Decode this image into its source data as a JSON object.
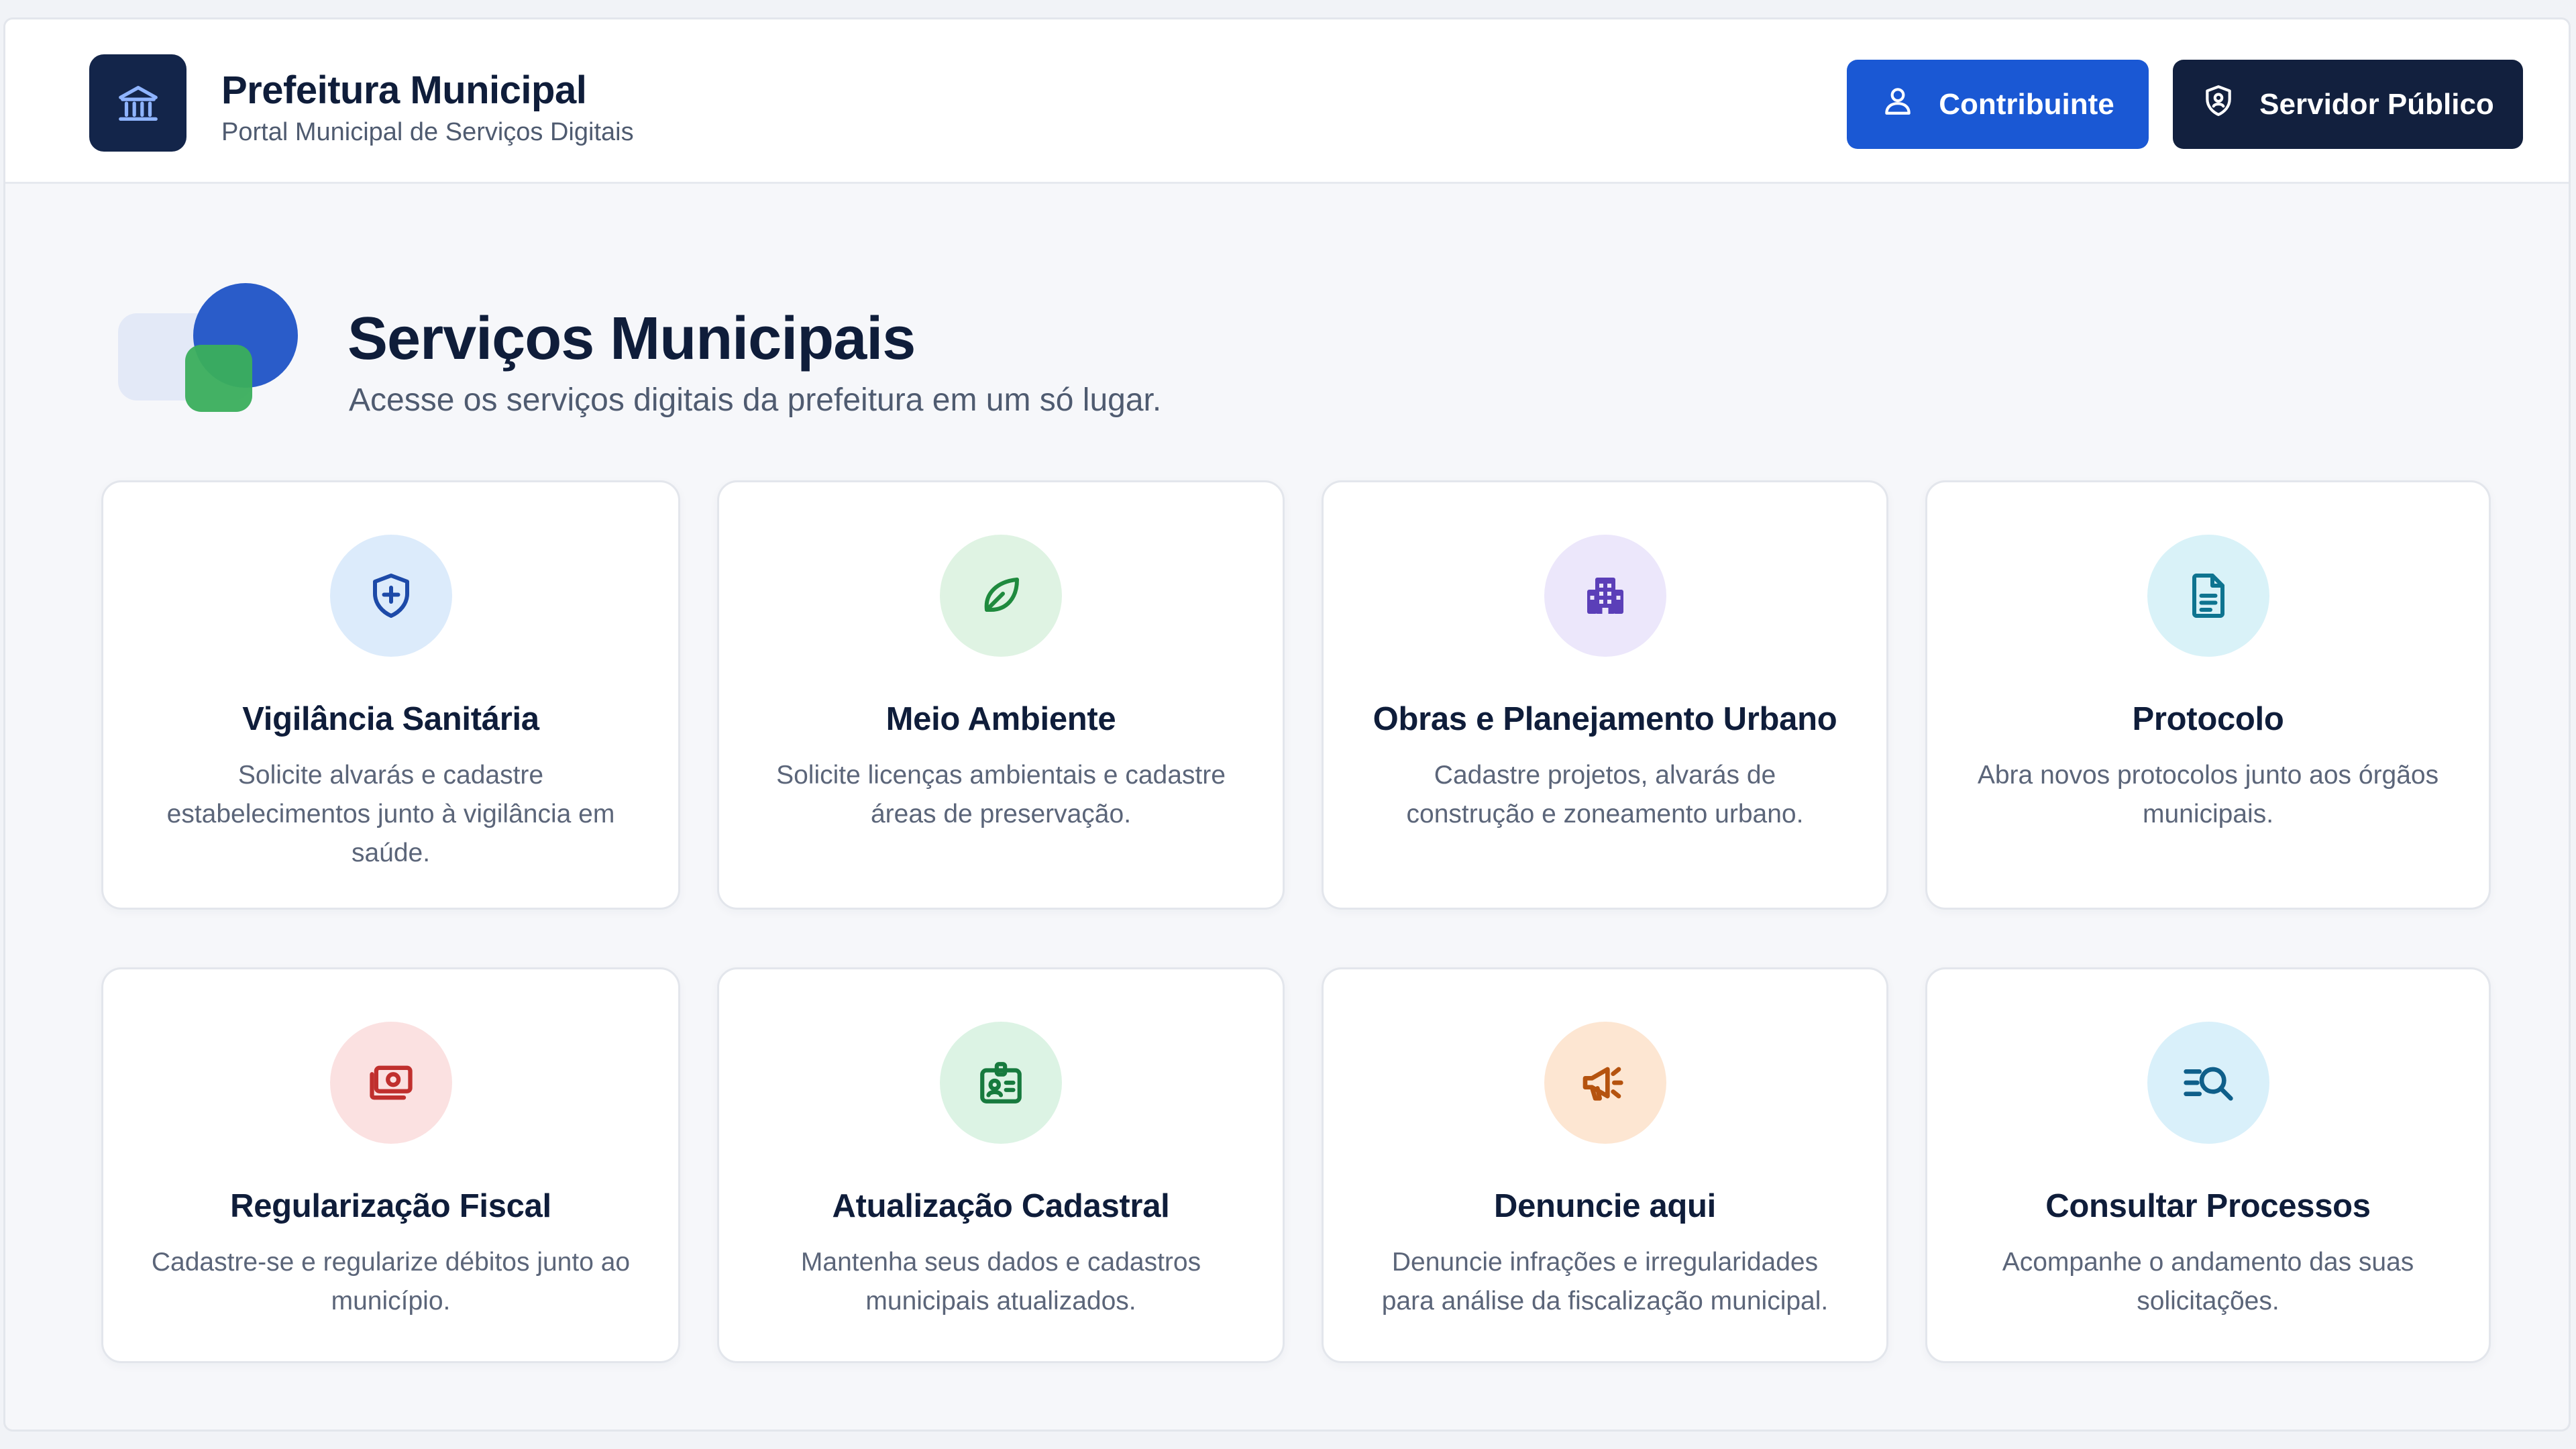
{
  "header": {
    "title": "Prefeitura Municipal",
    "subtitle": "Portal Municipal de Serviços Digitais",
    "btn_contribuinte": "Contribuinte",
    "btn_servidor": "Servidor Público"
  },
  "hero": {
    "title": "Serviços Municipais",
    "subtitle": "Acesse os serviços digitais da prefeitura em um só lugar."
  },
  "colors": {
    "primary": "#1a58d4",
    "navy": "#12203e"
  },
  "services": [
    {
      "title": "Vigilância Sanitária",
      "desc": "Solicite alvarás e cadastre estabelecimentos junto à vigilância em saúde.",
      "icon": "shield-plus-icon"
    },
    {
      "title": "Meio Ambiente",
      "desc": "Solicite licenças ambientais e cadastre áreas de preservação.",
      "icon": "leaf-icon"
    },
    {
      "title": "Obras e Planejamento Urbano",
      "desc": "Cadastre projetos, alvarás de construção e zoneamento urbano.",
      "icon": "building-icon"
    },
    {
      "title": "Protocolo",
      "desc": "Abra novos protocolos junto aos órgãos municipais.",
      "icon": "document-icon"
    },
    {
      "title": "Regularização Fiscal",
      "desc": "Cadastre-se e regularize débitos junto ao município.",
      "icon": "money-icon"
    },
    {
      "title": "Atualização Cadastral",
      "desc": "Mantenha seus dados e cadastros municipais atualizados.",
      "icon": "id-badge-icon"
    },
    {
      "title": "Denuncie aqui",
      "desc": "Denuncie infrações e irregularidades para análise da fiscalização municipal.",
      "icon": "megaphone-icon"
    },
    {
      "title": "Consultar Processos",
      "desc": "Acompanhe o andamento das suas solicitações.",
      "icon": "search-list-icon"
    }
  ]
}
